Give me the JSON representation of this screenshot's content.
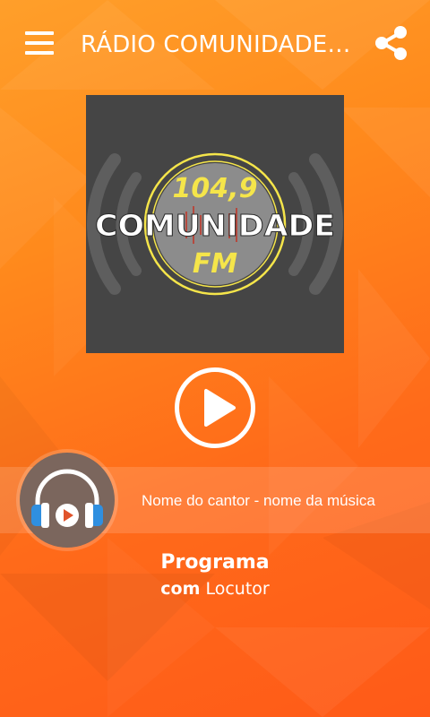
{
  "app_bar": {
    "title": "RÁDIO COMUNIDADE F...",
    "menu_icon": "hamburger-menu-icon",
    "share_icon": "share-icon"
  },
  "logo": {
    "frequency": "104,9",
    "name": "COMUNIDADE",
    "band": "FM"
  },
  "player": {
    "play_icon": "play-icon",
    "avatar_icon": "headphones-icon",
    "now_playing": "Nome do cantor - nome da música"
  },
  "program": {
    "title": "Programa",
    "host_prefix": "com",
    "host_name": "Locutor"
  },
  "colors": {
    "background_top": "#ff9f2a",
    "background_bottom": "#ff5a18",
    "logo_background": "#454545",
    "accent_yellow": "#f5e54a",
    "avatar_background": "#7b665d",
    "headphones_blue": "#2f8fe0",
    "play_red": "#e0532b"
  }
}
